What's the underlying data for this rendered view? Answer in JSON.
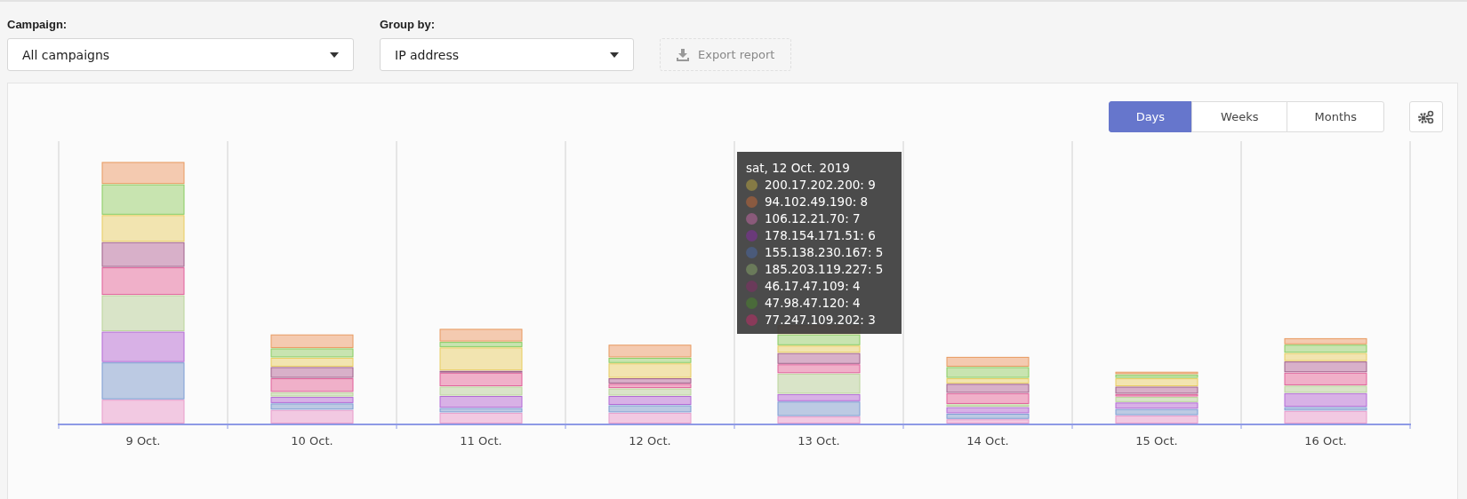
{
  "filters": [
    {
      "label": "Campaign:",
      "value": "All campaigns"
    },
    {
      "label": "Group by:",
      "value": "IP address"
    }
  ],
  "export_button": {
    "label": "Export report",
    "disabled": true
  },
  "period_tabs": [
    {
      "label": "Days",
      "selected": true
    },
    {
      "label": "Weeks",
      "selected": false
    },
    {
      "label": "Months",
      "selected": false
    }
  ],
  "chart": {
    "x_labels": [
      "9 Oct.",
      "10 Oct.",
      "11 Oct.",
      "12 Oct.",
      "13 Oct.",
      "14 Oct.",
      "15 Oct.",
      "16 Oct."
    ],
    "tooltip": {
      "title": "sat, 12 Oct. 2019",
      "items": [
        {
          "label": "200.17.202.200: 9",
          "color": "#857a45"
        },
        {
          "label": "94.102.49.190: 8",
          "color": "#8a5a40"
        },
        {
          "label": "106.12.21.70: 7",
          "color": "#8a5a7a"
        },
        {
          "label": "178.154.171.51: 6",
          "color": "#6a3a7a"
        },
        {
          "label": "155.138.230.167: 5",
          "color": "#4a5a7a"
        },
        {
          "label": "185.203.119.227: 5",
          "color": "#6a7a5a"
        },
        {
          "label": "46.17.47.109: 4",
          "color": "#6a3a5a"
        },
        {
          "label": "47.98.47.120: 4",
          "color": "#4a6a3a"
        },
        {
          "label": "77.247.109.202: 3",
          "color": "#8a3a5a"
        }
      ]
    }
  }
}
